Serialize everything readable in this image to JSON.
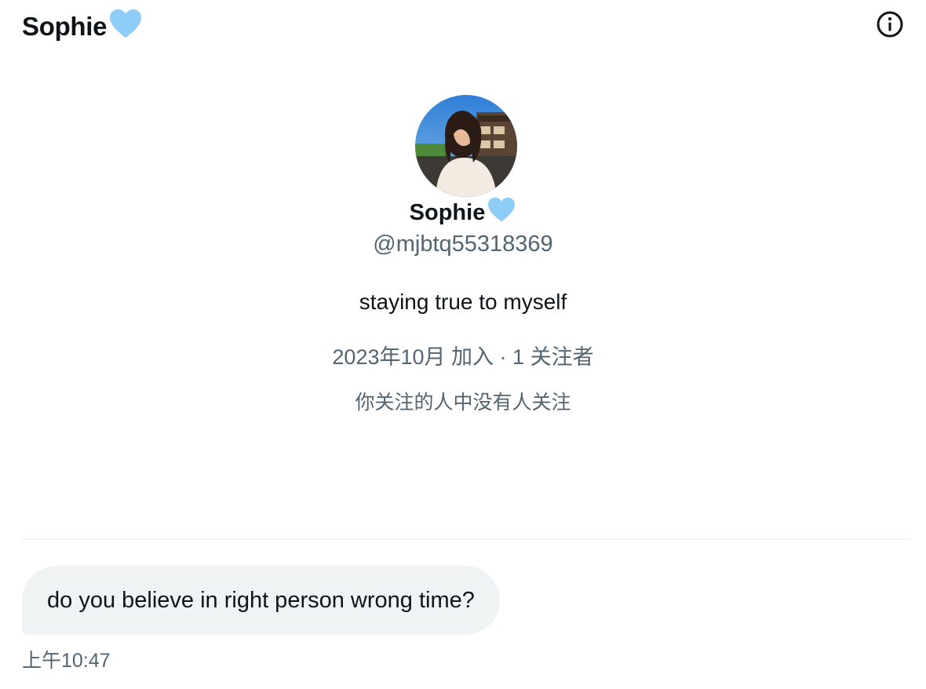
{
  "header": {
    "title": "Sophie",
    "emoji_icon": "blue-heart-icon",
    "info_icon": "info-icon"
  },
  "profile": {
    "avatar_icon": "avatar",
    "name": "Sophie",
    "handle": "@mjbtq55318369",
    "bio": "staying true to myself",
    "joined": "2023年10月 加入",
    "separator": "·",
    "followers": "1 关注者",
    "mutual_note": "你关注的人中没有人关注"
  },
  "message": {
    "text": "do you believe in right person wrong time?",
    "time": "上午10:47"
  },
  "colors": {
    "heart": "#8ecdf8",
    "secondary_text": "#536471",
    "bubble_bg": "#eff3f4",
    "primary_text": "#0f1419"
  }
}
